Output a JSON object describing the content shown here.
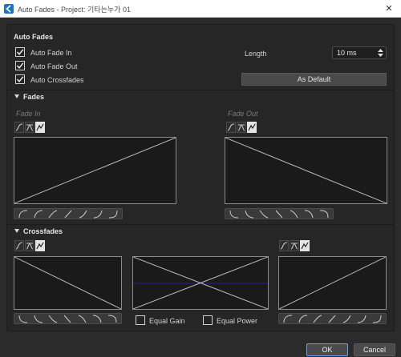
{
  "window": {
    "title": "Auto Fades - Project: 기타는누가 01"
  },
  "auto_fades": {
    "title": "Auto Fades",
    "checkboxes": [
      {
        "label": "Auto Fade In",
        "checked": true
      },
      {
        "label": "Auto Fade Out",
        "checked": true
      },
      {
        "label": "Auto Crossfades",
        "checked": true
      }
    ],
    "length_label": "Length",
    "length_value": "10 ms",
    "default_button": "As Default"
  },
  "fades": {
    "title": "Fades",
    "fade_in_label": "Fade In",
    "fade_out_label": "Fade Out"
  },
  "crossfades": {
    "title": "Crossfades",
    "equal_gain_label": "Equal Gain",
    "equal_power_label": "Equal Power"
  },
  "footer": {
    "ok": "OK",
    "cancel": "Cancel"
  },
  "colors": {
    "accent": "#1a73c8",
    "crossfade_line": "#1d1d8a",
    "ok_border": "#6aa1e8"
  }
}
